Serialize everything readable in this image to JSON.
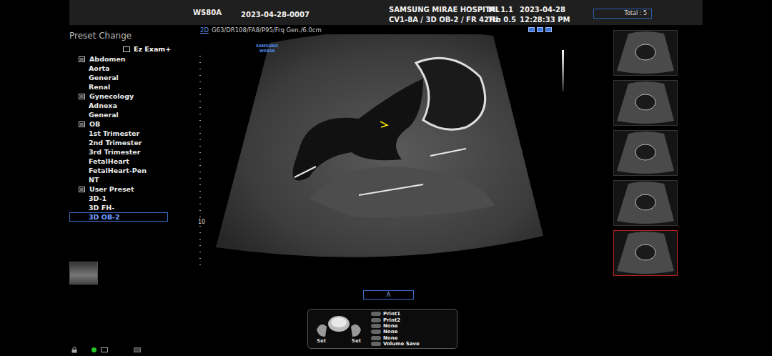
{
  "header": {
    "model": "WS80A",
    "patient_id": "2023-04-28-0007",
    "hospital": "SAMSUNG MIRAE HOSPITAL",
    "probe_line": "CV1-8A / 3D OB-2 / FR 42Hz",
    "mi": "MI 1.1",
    "tib": "TIb 0.5",
    "date": "2023-04-28",
    "time": "12:28:33 PM",
    "total": "Total : 5"
  },
  "imaging": {
    "mode": "2D",
    "params": "G63/DR108/FA8/P95/Frq Gen./6.0cm",
    "logo": [
      "SAMSUNG",
      "WS80A"
    ],
    "depth_label": "10",
    "marker": "A"
  },
  "sidebar": {
    "title": "Preset Change",
    "shortcut": "Ez Exam+",
    "items": [
      {
        "label": "Abdomen",
        "kind": "group",
        "selected": false
      },
      {
        "label": "Aorta",
        "kind": "item",
        "selected": false
      },
      {
        "label": "General",
        "kind": "item",
        "selected": false
      },
      {
        "label": "Renal",
        "kind": "item",
        "selected": false
      },
      {
        "label": "Gynecology",
        "kind": "group",
        "selected": false
      },
      {
        "label": "Adnexa",
        "kind": "item",
        "selected": false
      },
      {
        "label": "General",
        "kind": "item",
        "selected": false
      },
      {
        "label": "OB",
        "kind": "group",
        "selected": false
      },
      {
        "label": "1st Trimester",
        "kind": "item",
        "selected": false
      },
      {
        "label": "2nd Trimester",
        "kind": "item",
        "selected": false
      },
      {
        "label": "3rd Trimester",
        "kind": "item",
        "selected": false
      },
      {
        "label": "FetalHeart",
        "kind": "item",
        "selected": false
      },
      {
        "label": "FetalHeart-Pen",
        "kind": "item",
        "selected": false
      },
      {
        "label": "NT",
        "kind": "item",
        "selected": false
      },
      {
        "label": "User Preset",
        "kind": "group",
        "selected": false
      },
      {
        "label": "3D-1",
        "kind": "item",
        "selected": false
      },
      {
        "label": "3D FH-",
        "kind": "item",
        "selected": false
      },
      {
        "label": "3D OB-2",
        "kind": "item",
        "selected": true
      }
    ]
  },
  "thumbnails": [
    {
      "selected": false
    },
    {
      "selected": false
    },
    {
      "selected": false
    },
    {
      "selected": false
    },
    {
      "selected": true
    }
  ],
  "controls": {
    "buttons": [
      "Set",
      "Set"
    ],
    "keys": [
      "Print1",
      "Print2",
      "None",
      "None",
      "None",
      "Volume Save"
    ]
  },
  "status": {
    "power_on": true
  }
}
